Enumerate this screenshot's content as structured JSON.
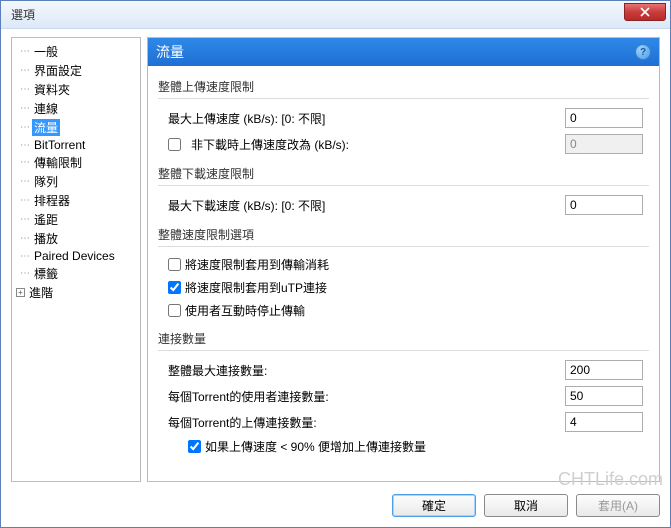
{
  "title": "選項",
  "sidebar": {
    "items": [
      {
        "label": "一般"
      },
      {
        "label": "界面設定"
      },
      {
        "label": "資料夾"
      },
      {
        "label": "連線"
      },
      {
        "label": "流量",
        "selected": true
      },
      {
        "label": "BitTorrent"
      },
      {
        "label": "傳輸限制"
      },
      {
        "label": "隊列"
      },
      {
        "label": "排程器"
      },
      {
        "label": "遙距"
      },
      {
        "label": "播放"
      },
      {
        "label": "Paired Devices"
      },
      {
        "label": "標籤"
      }
    ],
    "expander": "進階"
  },
  "panel": {
    "title": "流量",
    "upload": {
      "title": "整體上傳速度限制",
      "max_label": "最大上傳速度 (kB/s): [0: 不限]",
      "max_value": "0",
      "alt_label": "非下載時上傳速度改為 (kB/s):",
      "alt_value": "0"
    },
    "download": {
      "title": "整體下載速度限制",
      "max_label": "最大下載速度 (kB/s): [0: 不限]",
      "max_value": "0"
    },
    "options": {
      "title": "整體速度限制選項",
      "opt1": "將速度限制套用到傳輸消耗",
      "opt2": "將速度限制套用到uTP連接",
      "opt3": "使用者互動時停止傳輸"
    },
    "conn": {
      "title": "連接數量",
      "total_label": "整體最大連接數量:",
      "total_value": "200",
      "per_user_label": "每個Torrent的使用者連接數量:",
      "per_user_value": "50",
      "per_upload_label": "每個Torrent的上傳連接數量:",
      "per_upload_value": "4",
      "extra_label": "如果上傳速度 < 90% 便增加上傳連接數量"
    }
  },
  "buttons": {
    "ok": "確定",
    "cancel": "取消",
    "apply": "套用(A)"
  },
  "watermark": "CHTLife.com"
}
